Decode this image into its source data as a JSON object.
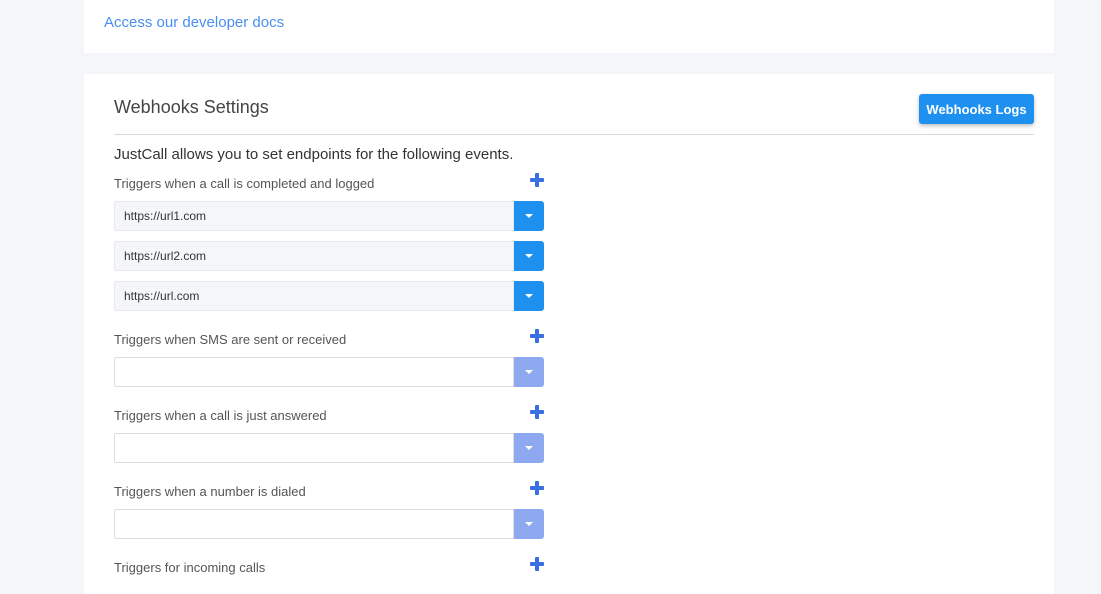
{
  "developer_docs": {
    "link_text": "Access our developer docs"
  },
  "webhooks": {
    "title": "Webhooks Settings",
    "logs_button": "Webhooks Logs",
    "intro": "JustCall allows you to set endpoints for the following events.",
    "sections": [
      {
        "label": "Triggers when a call is completed and logged",
        "urls": [
          "https://url1.com",
          "https://url2.com",
          "https://url.com"
        ]
      },
      {
        "label": "Triggers when SMS are sent or received",
        "urls": [
          ""
        ]
      },
      {
        "label": "Triggers when a call is just answered",
        "urls": [
          ""
        ]
      },
      {
        "label": "Triggers when a number is dialed",
        "urls": [
          ""
        ]
      },
      {
        "label": "Triggers for incoming calls",
        "urls": []
      }
    ]
  },
  "colors": {
    "accent": "#1e90f0",
    "accent_muted": "#8fa9f0",
    "plus": "#3b6fe0",
    "link": "#4a8ef0"
  },
  "icons": {
    "add": "plus-icon",
    "dropdown": "caret-down-icon"
  }
}
